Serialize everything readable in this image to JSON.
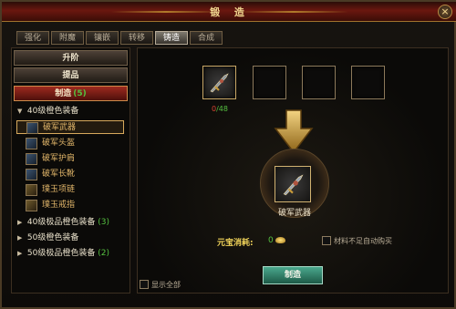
{
  "window": {
    "title": "锻 造",
    "close_glyph": "×"
  },
  "tabs": [
    "强化",
    "附魔",
    "镶嵌",
    "转移",
    "铸造",
    "合成"
  ],
  "active_tab": "铸造",
  "categories": [
    {
      "label": "升阶"
    },
    {
      "label": "提品"
    },
    {
      "label": "制造",
      "count": "(5)"
    }
  ],
  "tree": {
    "group1": {
      "arrow": "▼",
      "label": "40级橙色装备"
    },
    "items": [
      {
        "label": "破军武器",
        "icon": "sword-icon"
      },
      {
        "label": "破军头盔",
        "icon": "helmet-icon"
      },
      {
        "label": "破军护肩",
        "icon": "pauldron-icon"
      },
      {
        "label": "破军长靴",
        "icon": "boots-icon"
      },
      {
        "label": "璞玉项链",
        "icon": "necklace-icon"
      },
      {
        "label": "璞玉戒指",
        "icon": "ring-icon"
      }
    ],
    "groups": [
      {
        "arrow": "▶",
        "label": "40级极品橙色装备",
        "count": "(3)"
      },
      {
        "arrow": "▶",
        "label": "50级橙色装备",
        "count": ""
      },
      {
        "arrow": "▶",
        "label": "50级极品橙色装备",
        "count": "(2)"
      }
    ]
  },
  "material": {
    "have": "0",
    "need": "/48"
  },
  "result": {
    "label": "破军武器"
  },
  "cost": {
    "label": "元宝消耗:",
    "value": "0"
  },
  "auto_buy_label": "材料不足自动购买",
  "show_all_label": "显示全部",
  "make_button": "制造",
  "colors": {
    "accent_red": "#6a170f",
    "gold": "#d7a95c",
    "green": "#55c040",
    "make_btn": "#1d5a47"
  }
}
